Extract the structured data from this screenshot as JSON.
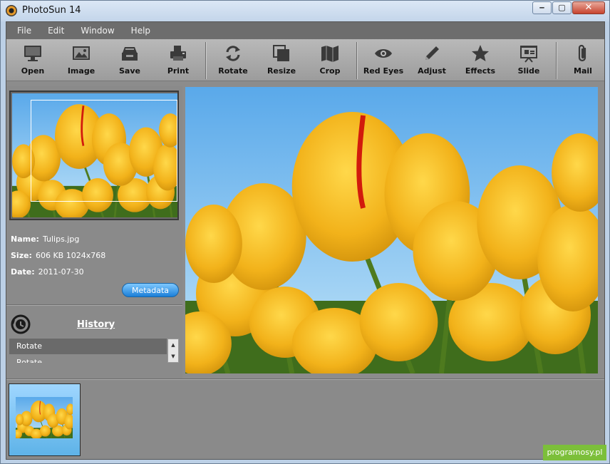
{
  "window": {
    "title": "PhotoSun 14",
    "minimize_glyph": "‒",
    "maximize_glyph": "▢",
    "close_glyph": "✕"
  },
  "menu": [
    "File",
    "Edit",
    "Window",
    "Help"
  ],
  "toolbar": [
    {
      "label": "Open",
      "icon": "monitor-icon"
    },
    {
      "label": "Image",
      "icon": "image-icon"
    },
    {
      "label": "Save",
      "icon": "save-tray-icon"
    },
    {
      "label": "Print",
      "icon": "printer-icon"
    },
    {
      "label": "Rotate",
      "icon": "rotate-icon"
    },
    {
      "label": "Resize",
      "icon": "resize-icon"
    },
    {
      "label": "Crop",
      "icon": "crop-map-icon"
    },
    {
      "label": "Red Eyes",
      "icon": "eye-icon"
    },
    {
      "label": "Adjust",
      "icon": "pencil-icon"
    },
    {
      "label": "Effects",
      "icon": "star-icon"
    },
    {
      "label": "Slide",
      "icon": "slideshow-icon"
    },
    {
      "label": "Mail",
      "icon": "paperclip-icon"
    }
  ],
  "file_info": {
    "name_label": "Name:",
    "name": "Tulips.jpg",
    "size_label": "Size:",
    "size": "606 KB  1024x768",
    "date_label": "Date:",
    "date": "2011-07-30",
    "metadata_button": "Metadata"
  },
  "history": {
    "title": "History",
    "items": [
      "Rotate",
      "Rotate"
    ]
  },
  "watermark": "programosy.pl",
  "colors": {
    "accent_button": "#1b7fd8",
    "toolbar_bg": "#b0b0b0",
    "panel_bg": "#8a8a8a",
    "watermark_bg": "#7cbf3a"
  }
}
